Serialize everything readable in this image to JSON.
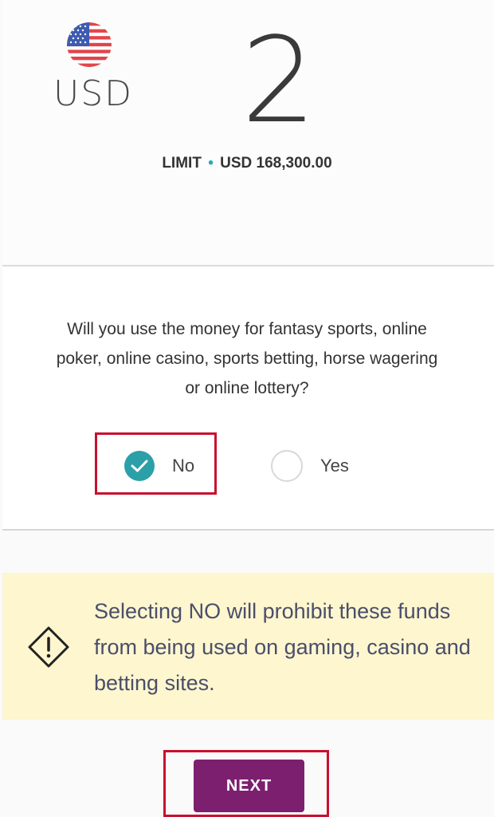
{
  "currency": {
    "code": "USD",
    "flag_icon": "us-flag-icon",
    "amount_digit": "2"
  },
  "limit": {
    "label": "LIMIT",
    "separator": "•",
    "value": "USD 168,300.00"
  },
  "question": {
    "text": "Will you use the money for fantasy sports, online poker, online casino, sports betting, horse wagering or online lottery?",
    "options": [
      {
        "label": "No",
        "selected": true
      },
      {
        "label": "Yes",
        "selected": false
      }
    ]
  },
  "warning": {
    "icon": "warning-diamond-icon",
    "text": "Selecting NO will prohibit these funds from being used on gaming, casino and betting sites."
  },
  "next_button": {
    "label": "NEXT"
  },
  "colors": {
    "accent_teal": "#2ba0a8",
    "button_purple": "#7d1f6f",
    "warning_bg": "#fdf6cf",
    "highlight_red": "#c8102e"
  }
}
